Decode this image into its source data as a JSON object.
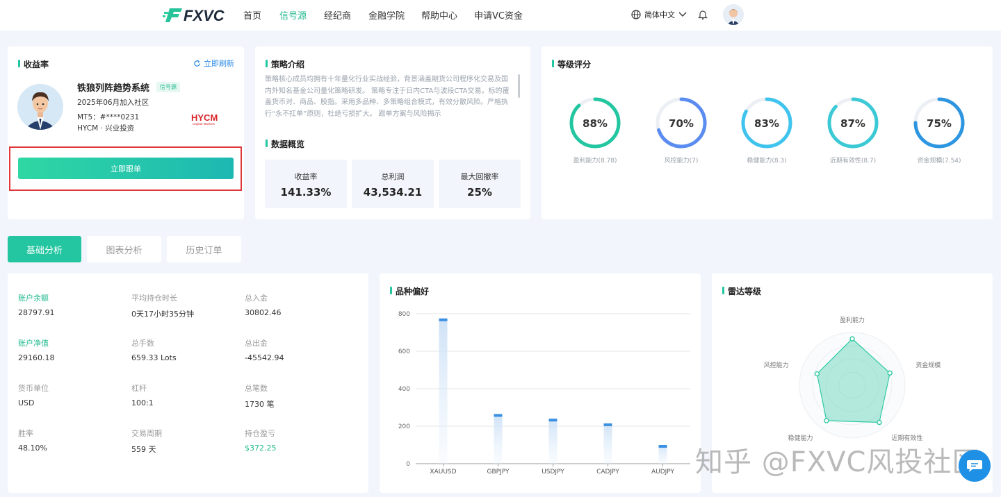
{
  "nav": {
    "logo": "FXVC",
    "items": [
      "首页",
      "信号源",
      "经纪商",
      "金融学院",
      "帮助中心",
      "申请VC资金"
    ],
    "active_index": 1,
    "language": "简体中文"
  },
  "profile": {
    "section_title": "收益率",
    "refresh_label": "立即刷新",
    "name": "铁狼列阵趋势系统",
    "badge": "信号源",
    "joined": "2025年06月加入社区",
    "mt_account": "MT5：#****0231",
    "broker": "HYCM · 兴业投资",
    "broker_logo": "HYCM",
    "broker_logo_sub": "Capital Markets",
    "follow_button": "立即跟单"
  },
  "strategy": {
    "title": "策略介绍",
    "text": "策略核心成员均拥有十年量化行业实战经验，背景涵盖期货公司程序化交易及国内外知名基金公司量化策略研发。 策略专注于日内CTA与波段CTA交易。标的覆盖货币对、商品、股指。采用多品种、多策略组合模式，有效分散风险。严格执行“永不扛单”原则，杜绝亏损扩大。 跟单方案与风险揭示"
  },
  "overview": {
    "title": "数据概览",
    "stats": [
      {
        "label": "收益率",
        "value": "141.33%"
      },
      {
        "label": "总利润",
        "value": "43,534.21"
      },
      {
        "label": "最大回撤率",
        "value": "25%"
      }
    ]
  },
  "rating": {
    "title": "等级评分",
    "gauges": [
      {
        "percent": 88,
        "display": "88%",
        "label": "盈利能力(8.78)",
        "color": "#22c6a0"
      },
      {
        "percent": 70,
        "display": "70%",
        "label": "风控能力(7)",
        "color": "#5b8cf0"
      },
      {
        "percent": 83,
        "display": "83%",
        "label": "稳健能力(8.3)",
        "color": "#3fc4ee"
      },
      {
        "percent": 87,
        "display": "87%",
        "label": "近期有效性(8.7)",
        "color": "#3cc9d6"
      },
      {
        "percent": 75,
        "display": "75%",
        "label": "资金规模(7.54)",
        "color": "#2e95e0"
      }
    ]
  },
  "tabs": [
    "基础分析",
    "图表分析",
    "历史订单"
  ],
  "basic": {
    "items": [
      {
        "label": "账户余额",
        "value": "28797.91",
        "highlight": true
      },
      {
        "label": "平均持仓时长",
        "value": "0天17小时35分钟"
      },
      {
        "label": "总入金",
        "value": "30802.46"
      },
      {
        "label": "账户净值",
        "value": "29160.18",
        "highlight": true
      },
      {
        "label": "总手数",
        "value": "659.33 Lots"
      },
      {
        "label": "总出金",
        "value": "-45542.94"
      },
      {
        "label": "货币单位",
        "value": "USD"
      },
      {
        "label": "杠杆",
        "value": "100:1"
      },
      {
        "label": "总笔数",
        "value": "1730 笔"
      },
      {
        "label": "胜率",
        "value": "48.10%"
      },
      {
        "label": "交易周期",
        "value": "559 天"
      },
      {
        "label": "持仓盈亏",
        "value": "$372.25",
        "value_green": true
      }
    ]
  },
  "preference": {
    "title": "品种偏好"
  },
  "chart_data": {
    "type": "bar",
    "categories": [
      "XAUUSD",
      "GBPJPY",
      "USDJPY",
      "CADJPY",
      "AUDJPY"
    ],
    "values": [
      775,
      265,
      240,
      215,
      100
    ],
    "ylim": [
      0,
      800
    ],
    "yticks": [
      0,
      200,
      400,
      600,
      800
    ],
    "grid": true
  },
  "radar": {
    "title": "雷达等级",
    "axes": [
      "盈利能力",
      "资金规模",
      "近期有效性",
      "稳健能力",
      "风控能力"
    ],
    "values": [
      0.88,
      0.75,
      0.87,
      0.83,
      0.7
    ],
    "color": "#2ec9a4"
  },
  "watermark": "知乎 @FXVC风投社区"
}
